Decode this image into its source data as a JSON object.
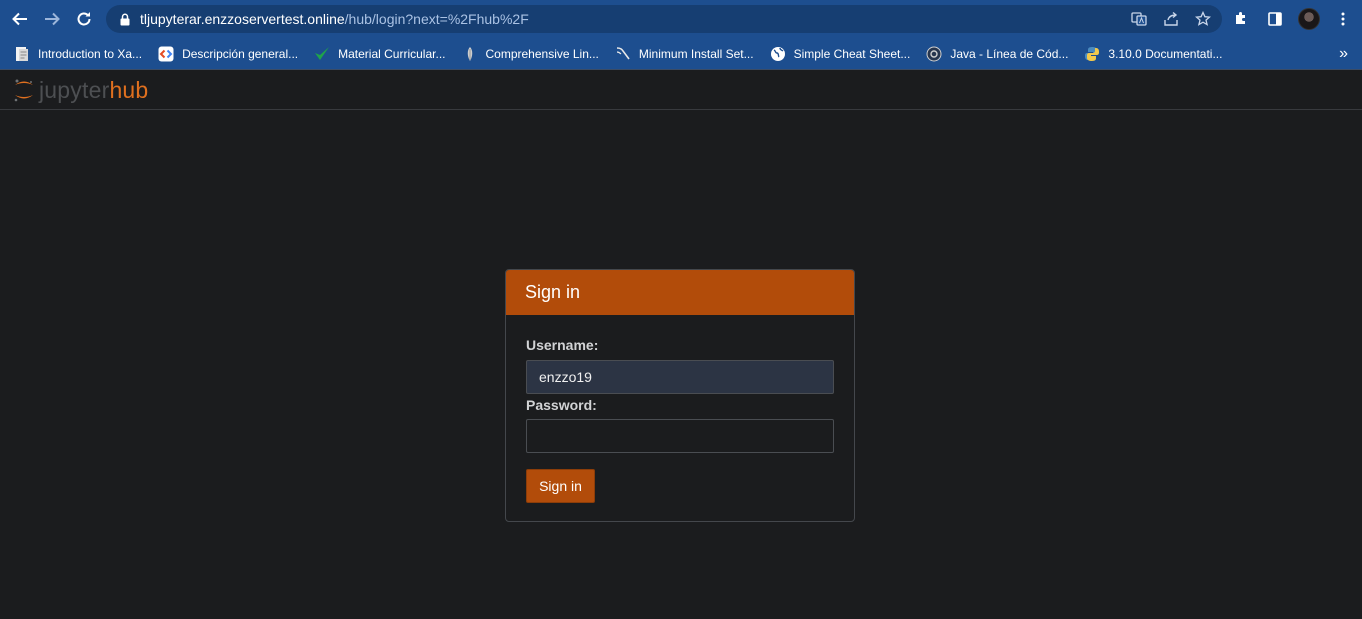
{
  "browser": {
    "url_host": "tljupyterar.enzzoservertest.online",
    "url_path": "/hub/login?next=%2Fhub%2F",
    "bookmarks": [
      {
        "label": "Introduction to Xa...",
        "icon": "document-icon",
        "color": "#e8e8e8"
      },
      {
        "label": "Descripción general...",
        "icon": "code-icon",
        "color": "#e34c26"
      },
      {
        "label": "Material Curricular...",
        "icon": "checkmark-icon",
        "color": "#1fa34a"
      },
      {
        "label": "Comprehensive Lin...",
        "icon": "feather-icon",
        "color": "#cfcfcf"
      },
      {
        "label": "Minimum Install Set...",
        "icon": "tool-icon",
        "color": "#e8e8e8"
      },
      {
        "label": "Simple Cheat Sheet...",
        "icon": "globe-icon",
        "color": "#ffffff"
      },
      {
        "label": "Java - Línea de Cód...",
        "icon": "eye-icon",
        "color": "#d0d0d0"
      },
      {
        "label": "3.10.0 Documentati...",
        "icon": "python-icon",
        "color": "#f2c94c"
      }
    ],
    "more_label": "»"
  },
  "hub": {
    "logo_jupyter": "jupyter",
    "logo_hub": "hub"
  },
  "login": {
    "title": "Sign in",
    "username_label": "Username:",
    "username_value": "enzzo19",
    "password_label": "Password:",
    "password_value": "",
    "submit_label": "Sign in"
  },
  "colors": {
    "accent": "#b24c0a",
    "chrome": "#1d4e8f",
    "background": "#1b1c1e"
  }
}
